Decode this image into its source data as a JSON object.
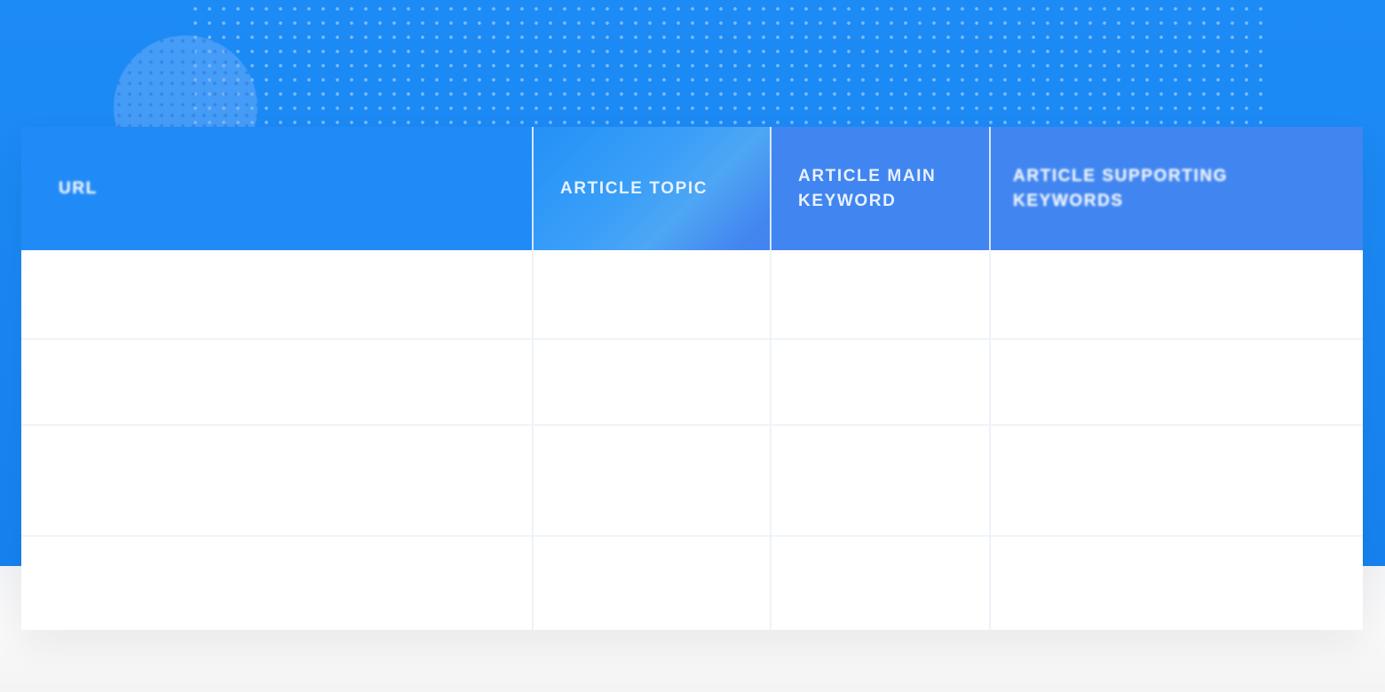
{
  "table": {
    "columns": [
      {
        "key": "url",
        "label": "URL"
      },
      {
        "key": "topic",
        "label": "ARTICLE TOPIC"
      },
      {
        "key": "main_keyword",
        "label": "ARTICLE MAIN KEYWORD"
      },
      {
        "key": "supporting_keywords",
        "label": "ARTICLE SUPPORTING KEYWORDS"
      }
    ],
    "rows": [
      {
        "url": "",
        "topic": "",
        "main_keyword": "",
        "supporting_keywords": ""
      },
      {
        "url": "",
        "topic": "",
        "main_keyword": "",
        "supporting_keywords": ""
      },
      {
        "url": "",
        "topic": "",
        "main_keyword": "",
        "supporting_keywords": ""
      },
      {
        "url": "",
        "topic": "",
        "main_keyword": "",
        "supporting_keywords": ""
      }
    ]
  },
  "colors": {
    "background_blue": "#1a86f2",
    "header_blue": "#208af6",
    "header_accent": "#4185f1",
    "header_text": "#e8f1fd",
    "table_body": "#ffffff",
    "grid_line": "#eef3f9"
  },
  "decorations": [
    "dot-pattern",
    "dotted-circle"
  ]
}
